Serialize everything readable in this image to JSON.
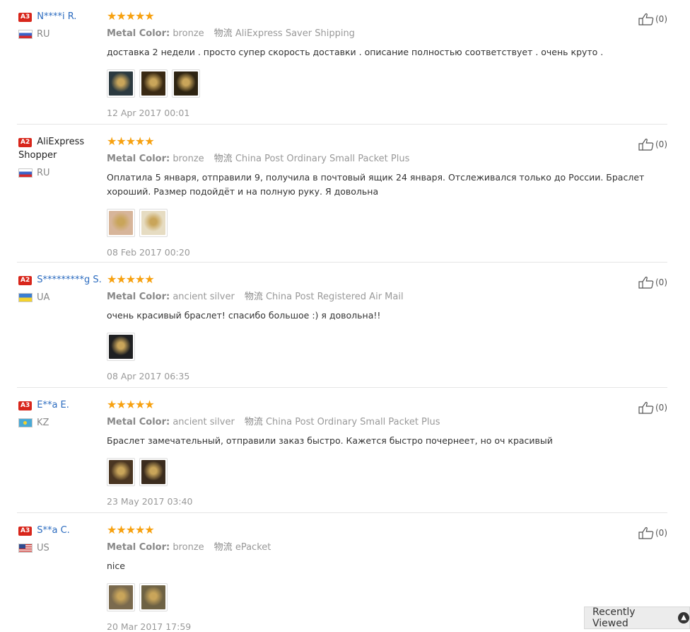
{
  "reviews": [
    {
      "badge": "A3",
      "name": "N****i R.",
      "name_style": "link",
      "country": "RU",
      "stars": "★★★★★",
      "color_label": "Metal Color:",
      "color_value": "bronze",
      "ship_label": "物流",
      "ship_value": "AliExpress Saver Shipping",
      "text": "доставка 2 недели . просто супер скорость доставки . описание полностью соответствует . очень круто .",
      "photos": [
        "#2c3a40",
        "#3a2a14",
        "#2e2412"
      ],
      "date": "12 Apr 2017 00:01",
      "likes": "(0)"
    },
    {
      "badge": "A2",
      "name": "AliExpress Shopper",
      "name_style": "plain",
      "country": "RU",
      "stars": "★★★★★",
      "color_label": "Metal Color:",
      "color_value": "bronze",
      "ship_label": "物流",
      "ship_value": "China Post Ordinary Small Packet Plus",
      "text": "Оплатила 5 января, отправили 9, получила в почтовый ящик 24 января. Отслеживался только до России. Браслет хороший. Размер подойдёт и на полную руку. Я довольна",
      "photos": [
        "#d7b59a",
        "#e6dcc2"
      ],
      "date": "08 Feb 2017 00:20",
      "likes": "(0)"
    },
    {
      "badge": "A2",
      "name": "S*********g S.",
      "name_style": "link",
      "country": "UA",
      "stars": "★★★★★",
      "color_label": "Metal Color:",
      "color_value": "ancient silver",
      "ship_label": "物流",
      "ship_value": "China Post Registered Air Mail",
      "text": "очень красивый браслет! спасибо большое :) я довольна!!",
      "photos": [
        "#1f2022"
      ],
      "date": "08 Apr 2017 06:35",
      "likes": "(0)"
    },
    {
      "badge": "A3",
      "name": "E**a E.",
      "name_style": "link",
      "country": "KZ",
      "stars": "★★★★★",
      "color_label": "Metal Color:",
      "color_value": "ancient silver",
      "ship_label": "物流",
      "ship_value": "China Post Ordinary Small Packet Plus",
      "text": "Браслет замечательный, отправили заказ быстро. Кажется быстро почернеет, но оч красивый",
      "photos": [
        "#4a3622",
        "#3b2c1e"
      ],
      "date": "23 May 2017 03:40",
      "likes": "(0)"
    },
    {
      "badge": "A3",
      "name": "S**a C.",
      "name_style": "link",
      "country": "US",
      "stars": "★★★★★",
      "color_label": "Metal Color:",
      "color_value": "bronze",
      "ship_label": "物流",
      "ship_value": "ePacket",
      "text": "nice",
      "photos": [
        "#7a6a4e",
        "#6e6244"
      ],
      "date": "20 Mar 2017 17:59",
      "likes": "(0)"
    }
  ],
  "recently_viewed": {
    "label": "Recently Viewed",
    "icon": "chevron-up-icon"
  }
}
